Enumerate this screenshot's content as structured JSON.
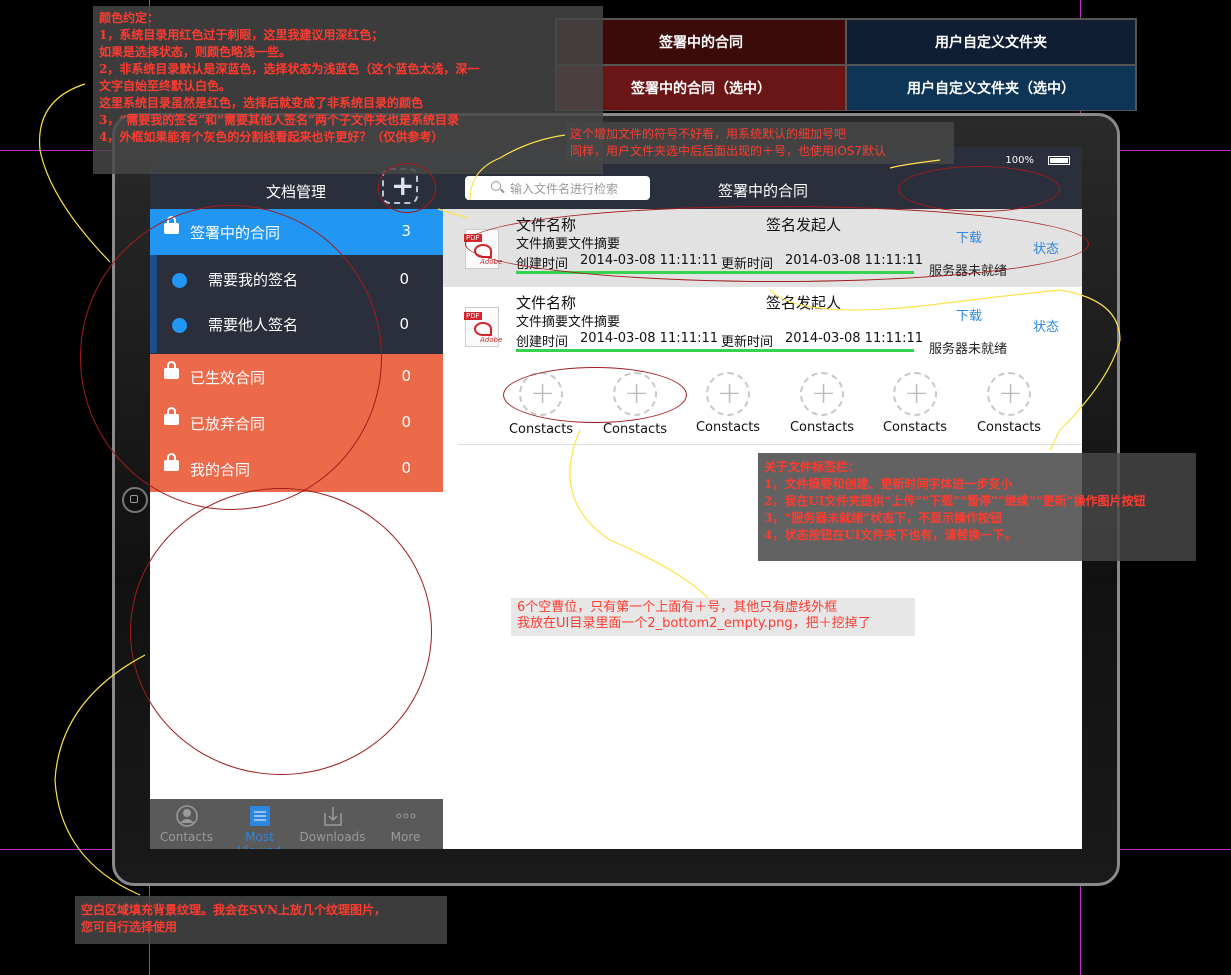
{
  "legend": {
    "signing": "签署中的合同",
    "custom": "用户自定义文件夹",
    "signing_selected": "签署中的合同（选中）",
    "custom_selected": "用户自定义文件夹（选中）",
    "colors": {
      "signing": "#3d0a0a",
      "custom": "#0f1e33",
      "signing_selected": "#6a1616",
      "custom_selected": "#0f3556"
    }
  },
  "status_bar": {
    "battery": "100%"
  },
  "left_panel": {
    "title": "文档管理",
    "add_icon": "+",
    "items": [
      {
        "label": "签署中的合同",
        "count": "3",
        "color": "#2296f3"
      },
      {
        "label": "需要我的签名",
        "count": "0"
      },
      {
        "label": "需要他人签名",
        "count": "0"
      },
      {
        "label": "已生效合同",
        "count": "0",
        "color": "#ec6a4a"
      },
      {
        "label": "已放弃合同",
        "count": "0",
        "color": "#ec6a4a"
      },
      {
        "label": "我的合同",
        "count": "0",
        "color": "#ec6a4a"
      }
    ],
    "tabs": [
      {
        "label": "Contacts",
        "icon": "person-icon"
      },
      {
        "label": "Most Viewed",
        "icon": "list-icon"
      },
      {
        "label": "Downloads",
        "icon": "download-icon"
      },
      {
        "label": "More",
        "icon": "more-icon"
      }
    ]
  },
  "right_panel": {
    "search_placeholder": "输入文件名进行检索",
    "title": "签署中的合同",
    "documents": [
      {
        "name": "文件名称",
        "signer": "签名发起人",
        "summary": "文件摘要文件摘要",
        "created_label": "创建时间",
        "created": "2014-03-08 11:11:11",
        "updated_label": "更新时间",
        "updated": "2014-03-08 11:11:11",
        "download": "下载",
        "status": "状态",
        "server": "服务器未就绪",
        "progress": 1.0
      },
      {
        "name": "文件名称",
        "signer": "签名发起人",
        "summary": "文件摘要文件摘要",
        "created_label": "创建时间",
        "created": "2014-03-08 11:11:11",
        "updated_label": "更新时间",
        "updated": "2014-03-08 11:11:11",
        "download": "下载",
        "status": "状态",
        "server": "服务器未就绪",
        "progress": 1.0
      }
    ],
    "contacts": [
      "Constacts",
      "Constacts",
      "Constacts",
      "Constacts",
      "Constacts",
      "Constacts"
    ],
    "pdf_tag": "PDF",
    "pdf_brand": "Adobe"
  },
  "notes": {
    "colors": [
      "颜色约定：",
      "1，系统目录用红色过于刺眼，这里我建议用深红色；",
      "如果是选择状态，则颜色略浅一些。",
      "2，非系统目录默认是深蓝色，选择状态为浅蓝色（这个蓝色太浅，深一",
      "文字自始至终默认白色。",
      "这里系统目录虽然是红色，选择后就变成了非系统目录的颜色",
      "3，“需要我的签名”和“需要其他人签名”两个子文件夹也是系统目录",
      "4，外框如果能有个灰色的分割线看起来也许更好？（仅供参考）"
    ],
    "plus": [
      "这个增加文件的符号不好看，用系统默认的细加号吧",
      "同样，用户文件夹选中后后面出现的＋号，也使用iOS7默认"
    ],
    "tabs": [
      "关于文件标签栏：",
      "1，文件摘要和创建、更新时间字体进一步变小",
      "2，我在UI文件夹提供“上传”“下载”“暂停”“继续”“更新”操作图片按钮",
      "3，“服务器未就绪”状态下，不显示操作按钮",
      "4，状态按钮在UI文件夹下也有，请替换一下。"
    ],
    "slots": [
      "6个空曹位，只有第一个上面有＋号，其他只有虚线外框",
      "我放在UI目录里面一个2_bottom2_empty.png，把＋挖掉了"
    ],
    "texture": [
      "空白区域填充背景纹理。我会在SVN上放几个纹理图片，",
      "您可自行选择使用"
    ]
  }
}
